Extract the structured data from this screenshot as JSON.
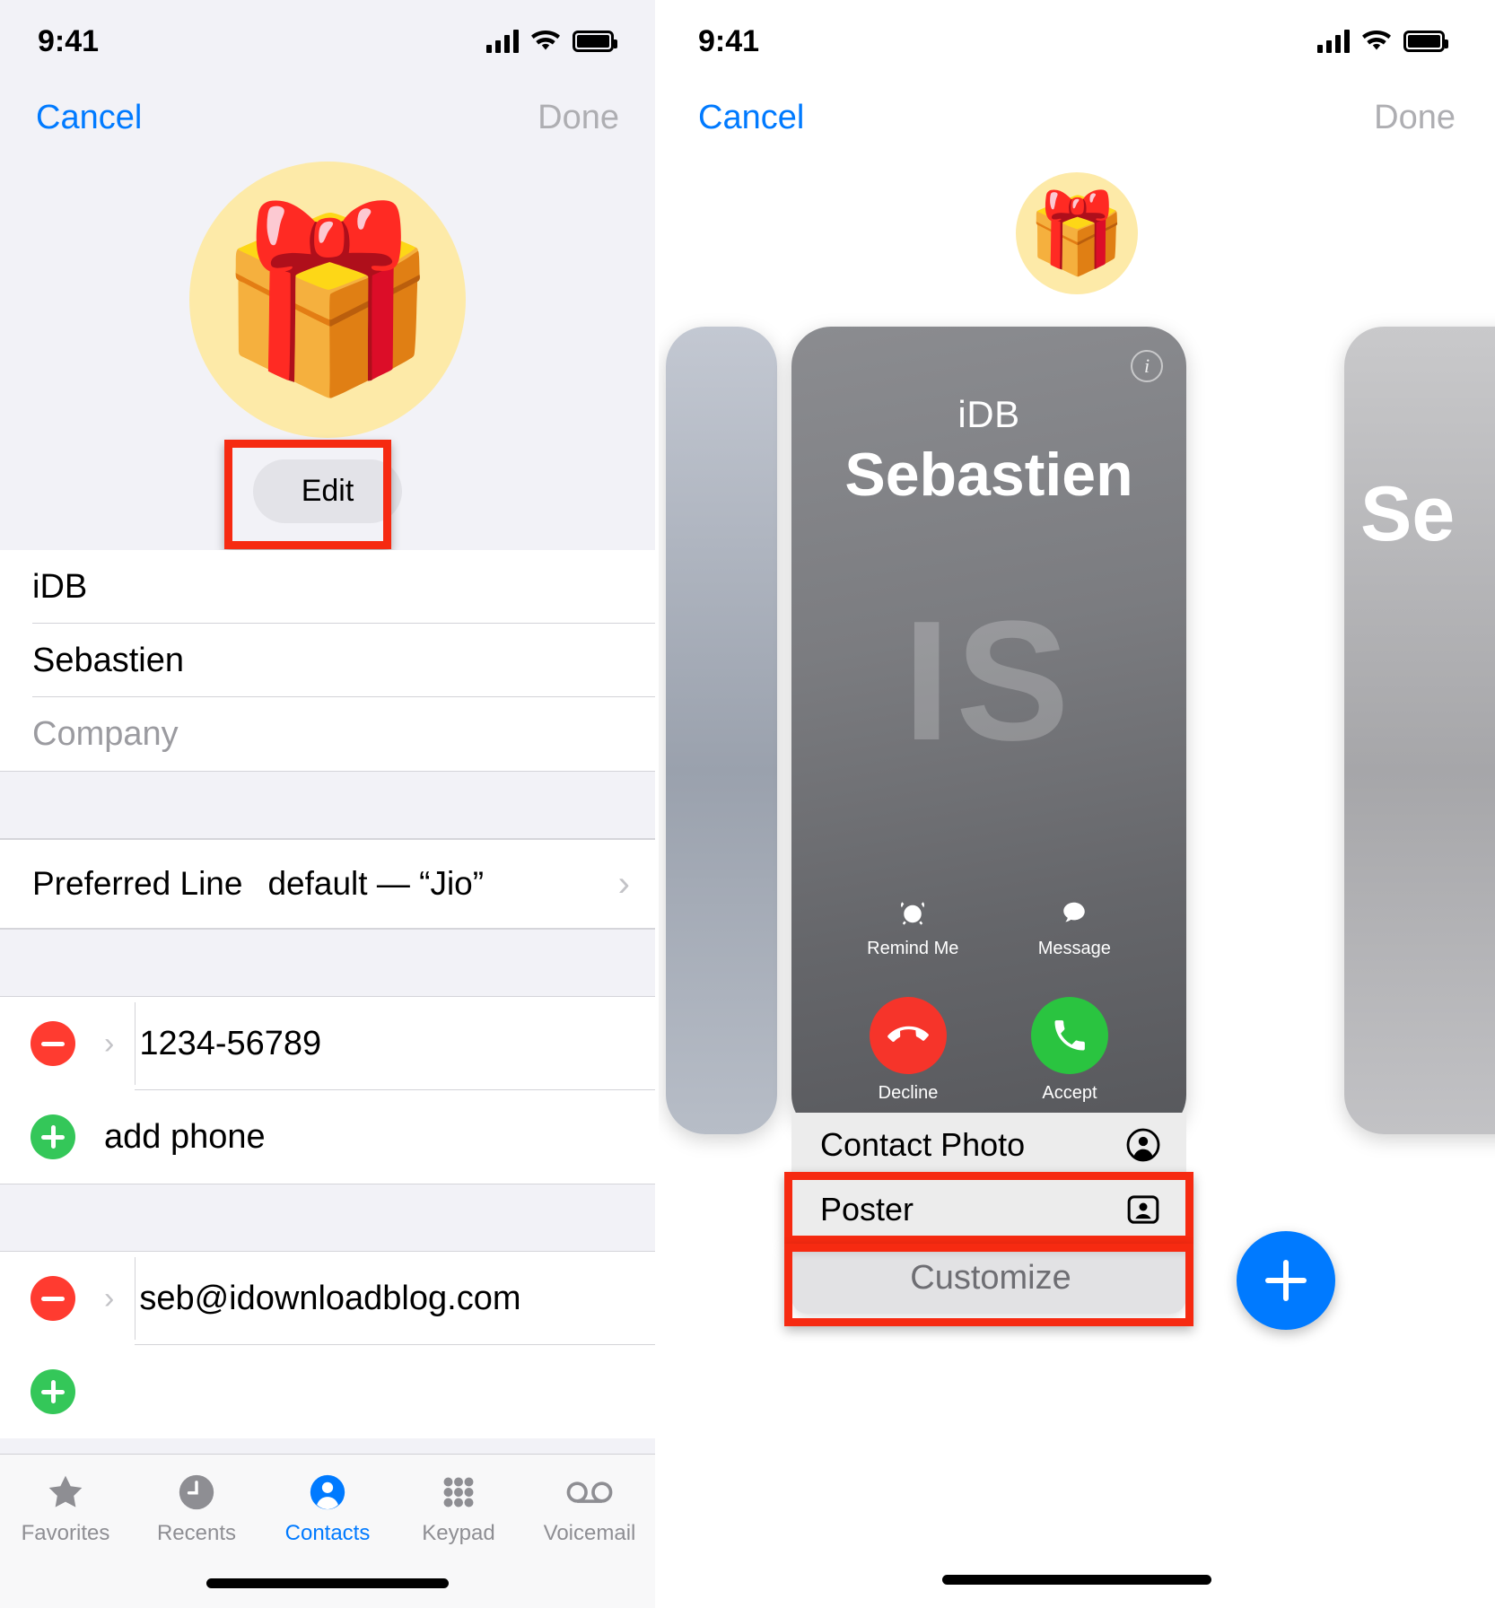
{
  "left": {
    "status": {
      "time": "9:41",
      "signal_icon": "cellular-bars-icon",
      "wifi_icon": "wifi-icon",
      "battery_icon": "battery-full-icon"
    },
    "nav": {
      "cancel": "Cancel",
      "done": "Done"
    },
    "avatar": {
      "emoji": "🎁",
      "background": "#fdeaa8"
    },
    "edit_button": {
      "label": "Edit",
      "highlight_color": "#f62a11"
    },
    "fields": [
      {
        "name": "first-name",
        "value": "iDB",
        "placeholder": "First name",
        "is_placeholder": false
      },
      {
        "name": "last-name",
        "value": "Sebastien",
        "placeholder": "Last name",
        "is_placeholder": false
      },
      {
        "name": "company",
        "value": "Company",
        "placeholder": "Company",
        "is_placeholder": true
      }
    ],
    "preferred_line": {
      "label": "Preferred Line",
      "value": "default — “Jio”",
      "chevron": "chevron-right-icon"
    },
    "phone_entries": [
      {
        "type": "remove",
        "value": "1234-56789"
      }
    ],
    "add_phone": {
      "label": "add phone"
    },
    "email_entries": [
      {
        "type": "remove",
        "value": "seb@idownloadblog.com"
      }
    ],
    "tabs": [
      {
        "id": "favorites",
        "label": "Favorites",
        "icon": "star-icon",
        "active": false
      },
      {
        "id": "recents",
        "label": "Recents",
        "icon": "clock-icon",
        "active": false
      },
      {
        "id": "contacts",
        "label": "Contacts",
        "icon": "person-circle-icon",
        "active": true
      },
      {
        "id": "keypad",
        "label": "Keypad",
        "icon": "keypad-grid-icon",
        "active": false
      },
      {
        "id": "voicemail",
        "label": "Voicemail",
        "icon": "voicemail-icon",
        "active": false
      }
    ]
  },
  "right": {
    "status": {
      "time": "9:41",
      "signal_icon": "cellular-bars-icon",
      "wifi_icon": "wifi-icon",
      "battery_icon": "battery-full-icon"
    },
    "nav": {
      "cancel": "Cancel",
      "done": "Done"
    },
    "avatar": {
      "emoji": "🎁",
      "background": "#fdeaa8"
    },
    "poster": {
      "info_badge": "i",
      "first_line": "iDB",
      "second_line": "Sebastien",
      "monogram": "IS",
      "actions": [
        {
          "id": "remind-me",
          "label": "Remind Me",
          "icon": "alarm-clock-icon"
        },
        {
          "id": "message",
          "label": "Message",
          "icon": "message-bubble-icon"
        }
      ],
      "call_buttons": [
        {
          "id": "decline",
          "label": "Decline",
          "icon": "phone-down-icon",
          "color": "#f6342a"
        },
        {
          "id": "accept",
          "label": "Accept",
          "icon": "phone-icon",
          "color": "#2ac440"
        }
      ]
    },
    "neighbor_card_text": "Se",
    "options": [
      {
        "id": "contact-photo",
        "label": "Contact Photo",
        "icon": "person-circle-icon",
        "highlighted": false
      },
      {
        "id": "poster",
        "label": "Poster",
        "icon": "poster-card-icon",
        "highlighted": true
      },
      {
        "id": "customize",
        "label": "Customize",
        "icon": "",
        "highlighted": true
      }
    ],
    "add_button": {
      "icon": "plus-icon",
      "color": "#007aff"
    }
  }
}
